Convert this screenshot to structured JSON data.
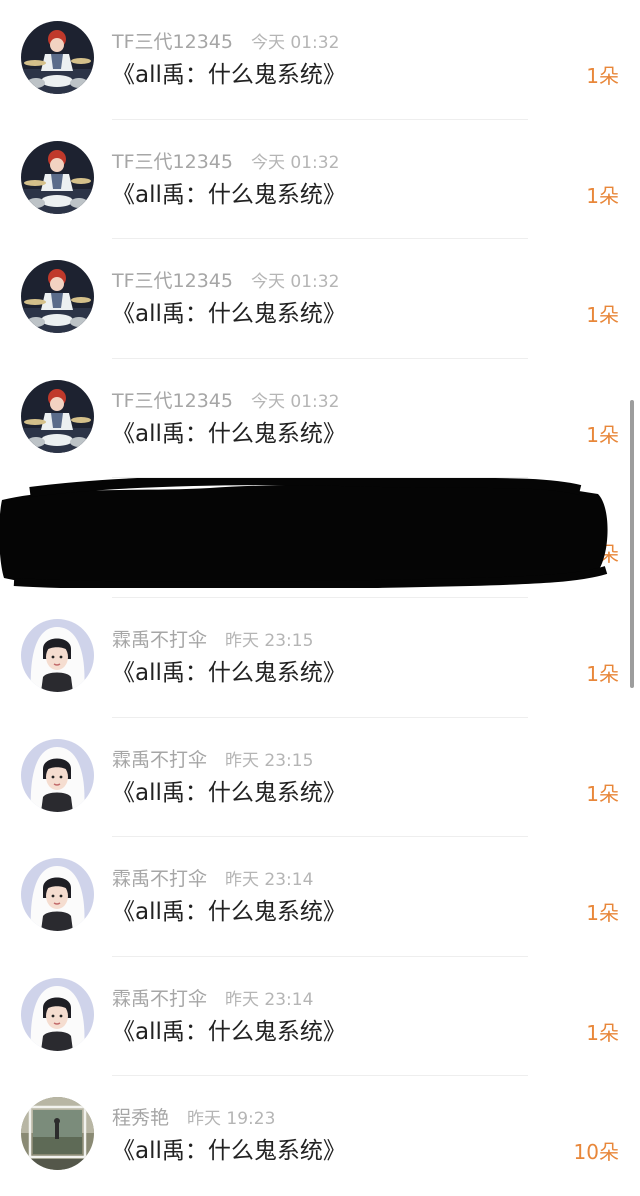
{
  "gift_list": [
    {
      "user": "TF三代12345",
      "time": "今天 01:32",
      "title": "《all禹：什么鬼系统》",
      "count": "1朵",
      "avatar": "drummer-avatar-icon"
    },
    {
      "user": "TF三代12345",
      "time": "今天 01:32",
      "title": "《all禹：什么鬼系统》",
      "count": "1朵",
      "avatar": "drummer-avatar-icon"
    },
    {
      "user": "TF三代12345",
      "time": "今天 01:32",
      "title": "《all禹：什么鬼系统》",
      "count": "1朵",
      "avatar": "drummer-avatar-icon"
    },
    {
      "user": "TF三代12345",
      "time": "今天 01:32",
      "title": "《all禹：什么鬼系统》",
      "count": "1朵",
      "avatar": "drummer-avatar-icon"
    },
    {
      "user": "",
      "time": "",
      "title": "",
      "count": "1朵",
      "avatar": "redacted-avatar-icon"
    },
    {
      "user": "霖禹不打伞",
      "time": "昨天 23:15",
      "title": "《all禹：什么鬼系统》",
      "count": "1朵",
      "avatar": "white-hood-avatar-icon"
    },
    {
      "user": "霖禹不打伞",
      "time": "昨天 23:15",
      "title": "《all禹：什么鬼系统》",
      "count": "1朵",
      "avatar": "white-hood-avatar-icon"
    },
    {
      "user": "霖禹不打伞",
      "time": "昨天 23:14",
      "title": "《all禹：什么鬼系统》",
      "count": "1朵",
      "avatar": "white-hood-avatar-icon"
    },
    {
      "user": "霖禹不打伞",
      "time": "昨天 23:14",
      "title": "《all禹：什么鬼系统》",
      "count": "1朵",
      "avatar": "white-hood-avatar-icon"
    },
    {
      "user": "程秀艳",
      "time": "昨天 19:23",
      "title": "《all禹：什么鬼系统》",
      "count": "10朵",
      "avatar": "framed-photo-avatar-icon"
    }
  ],
  "colors": {
    "count_accent": "#e8873a",
    "username": "#a6a6a6",
    "title_text": "#222222"
  }
}
